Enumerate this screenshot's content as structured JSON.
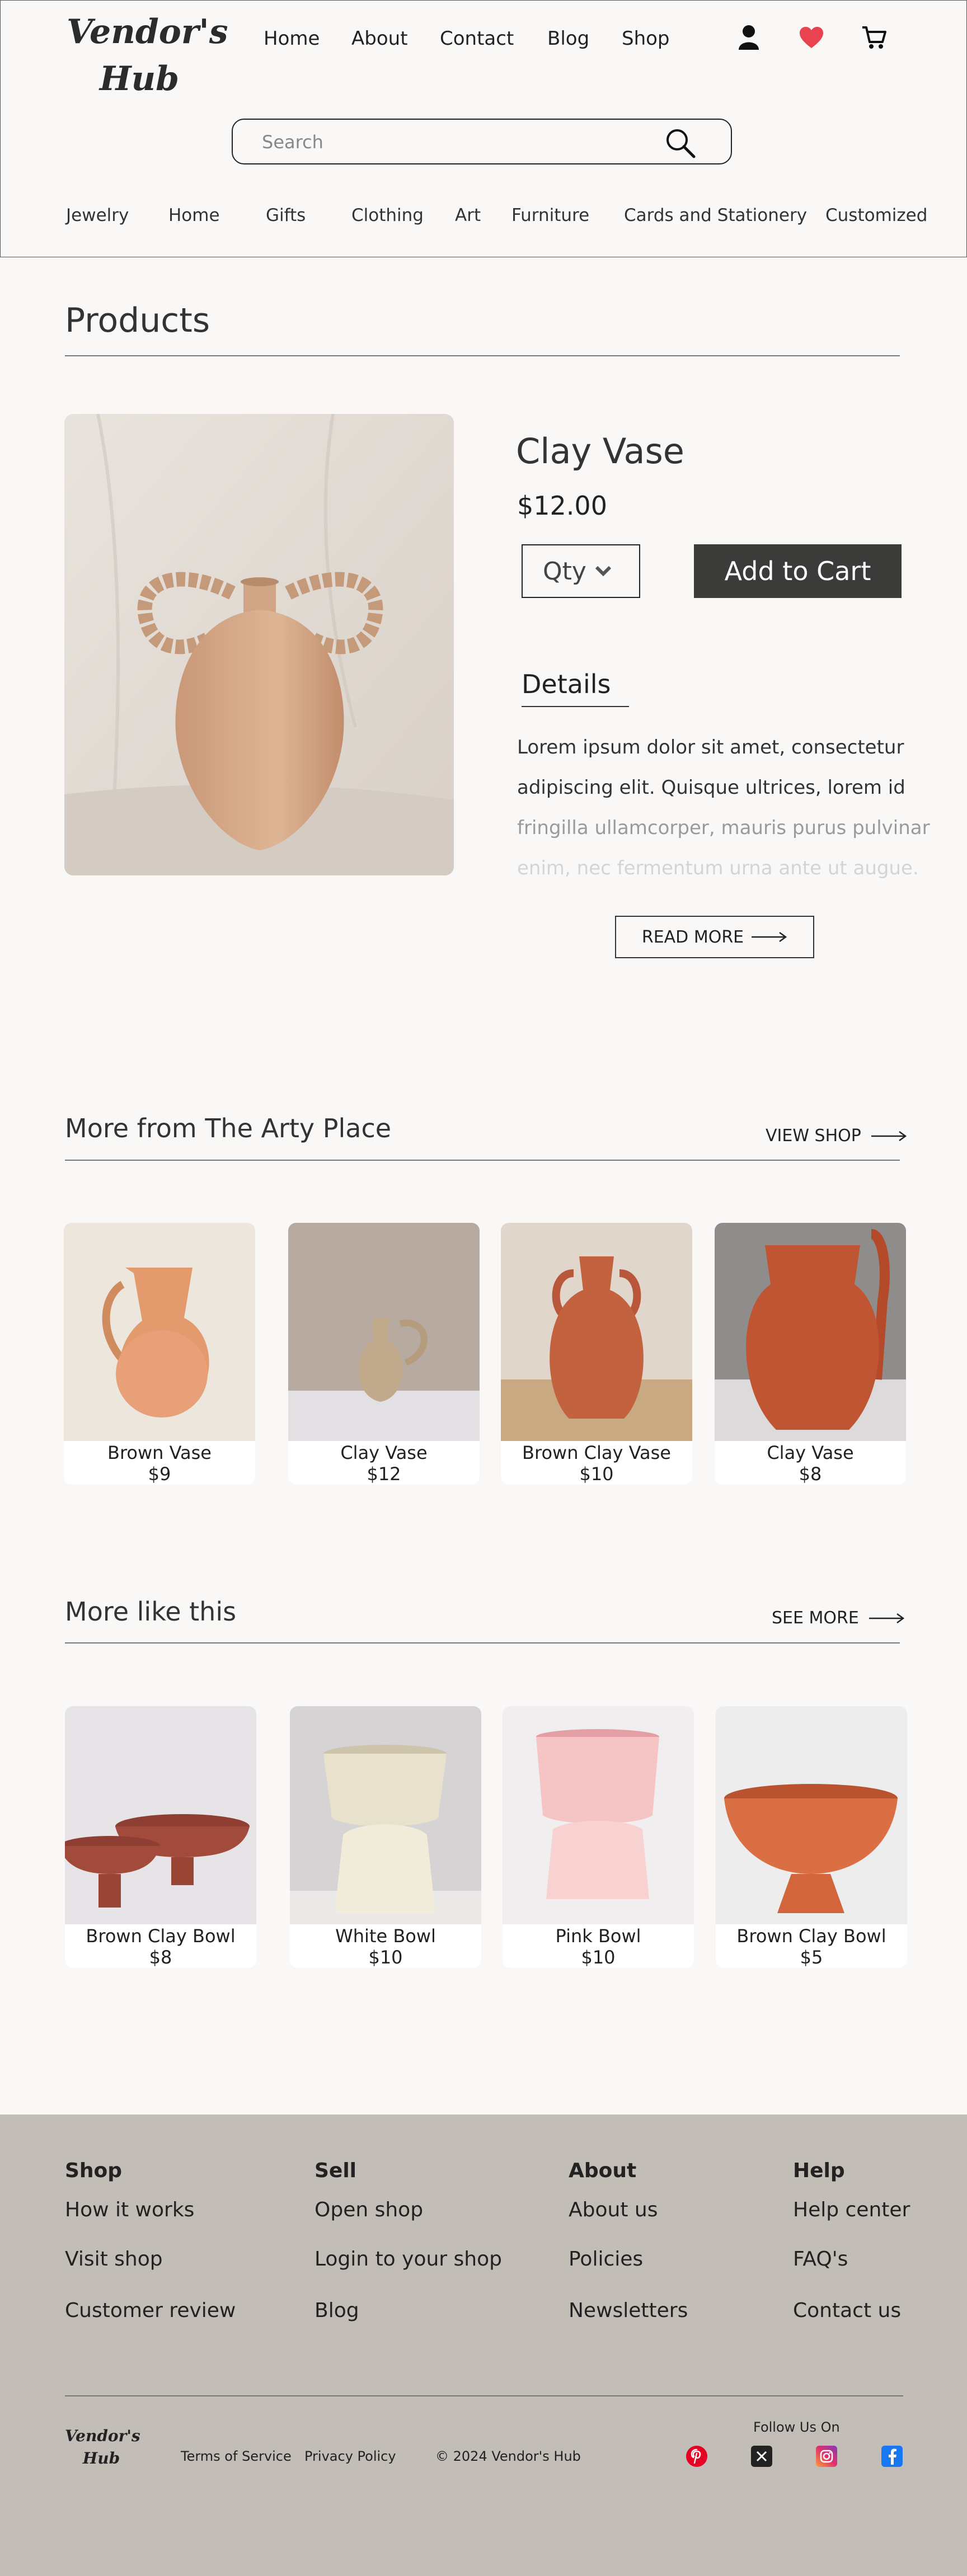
{
  "header": {
    "logo": "Vendor's Hub",
    "nav": [
      "Home",
      "About",
      "Contact",
      "Blog",
      "Shop"
    ],
    "search_placeholder": "Search",
    "categories": [
      "Jewelry",
      "Home",
      "Gifts",
      "Clothing",
      "Art",
      "Furniture",
      "Cards and Stationery",
      "Customized"
    ],
    "icons": [
      "user-icon",
      "heart-icon",
      "cart-icon",
      "search-icon"
    ],
    "heart_color": "#e8434f"
  },
  "products": {
    "heading": "Products",
    "title": "Clay Vase",
    "price": "$12.00",
    "qty_label": "Qty",
    "add_to_cart": "Add to Cart",
    "details_heading": "Details",
    "details_lines": [
      "Lorem ipsum dolor sit amet, consectetur",
      "adipiscing elit. Quisque ultrices, lorem id",
      "fringilla ullamcorper, mauris purus pulvinar",
      "enim, nec fermentum urna ante ut augue."
    ],
    "read_more": "READ MORE"
  },
  "more_from": {
    "heading": "More from The Arty Place",
    "link": "VIEW SHOP",
    "items": [
      {
        "name": "Brown Vase",
        "price": "$9"
      },
      {
        "name": "Clay Vase",
        "price": "$12"
      },
      {
        "name": "Brown Clay Vase",
        "price": "$10"
      },
      {
        "name": "Clay Vase",
        "price": "$8"
      }
    ]
  },
  "more_like": {
    "heading": "More like this",
    "link": "SEE MORE",
    "items": [
      {
        "name": "Brown Clay Bowl",
        "price": "$8"
      },
      {
        "name": "White Bowl",
        "price": "$10"
      },
      {
        "name": "Pink Bowl",
        "price": "$10"
      },
      {
        "name": "Brown Clay Bowl",
        "price": "$5"
      }
    ]
  },
  "footer": {
    "columns": [
      {
        "title": "Shop",
        "links": [
          "How it works",
          "Visit shop",
          "Customer review"
        ]
      },
      {
        "title": "Sell",
        "links": [
          "Open shop",
          "Login to your shop",
          "Blog"
        ]
      },
      {
        "title": "About",
        "links": [
          "About us",
          "Policies",
          "Newsletters"
        ]
      },
      {
        "title": "Help",
        "links": [
          "Help center",
          "FAQ's",
          "Contact us"
        ]
      }
    ],
    "logo": "Vendor's Hub",
    "terms": "Terms of Service",
    "privacy": "Privacy Policy",
    "copyright_symbol": "©",
    "copyright": "2024 Vendor's Hub",
    "follow": "Follow Us On",
    "social": [
      "pinterest-icon",
      "x-icon",
      "instagram-icon",
      "facebook-icon"
    ]
  }
}
